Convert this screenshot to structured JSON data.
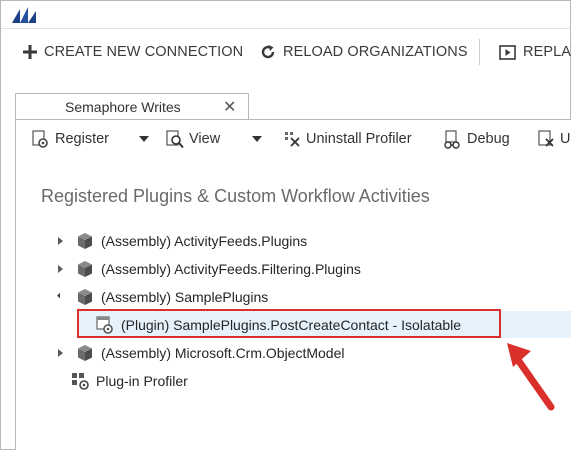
{
  "main_toolbar": {
    "create_connection": "CREATE NEW CONNECTION",
    "reload_organizations": "RELOAD ORGANIZATIONS",
    "replay": "REPLAY"
  },
  "tab": {
    "label": "Semaphore Writes",
    "close_glyph": "✕"
  },
  "sub_toolbar": {
    "register": "Register",
    "view": "View",
    "uninstall_profiler": "Uninstall Profiler",
    "debug": "Debug",
    "unregister_partial": "U"
  },
  "section_title": "Registered Plugins & Custom Workflow Activities",
  "tree": {
    "items": [
      {
        "label": "(Assembly) ActivityFeeds.Plugins",
        "expanded": false,
        "icon": "assembly-icon"
      },
      {
        "label": "(Assembly) ActivityFeeds.Filtering.Plugins",
        "expanded": false,
        "icon": "assembly-icon"
      },
      {
        "label": "(Assembly) SamplePlugins",
        "expanded": true,
        "icon": "assembly-icon"
      },
      {
        "label": "(Plugin) SamplePlugins.PostCreateContact - Isolatable",
        "selected": true,
        "icon": "plugin-icon"
      },
      {
        "label": "(Assembly) Microsoft.Crm.ObjectModel",
        "expanded": false,
        "icon": "assembly-icon"
      },
      {
        "label": "Plug-in Profiler",
        "icon": "profiler-icon"
      }
    ]
  },
  "colors": {
    "highlight_red": "#d9302b",
    "selection_blue": "#e5f1fb",
    "logo_blue": "#1d3f87"
  }
}
